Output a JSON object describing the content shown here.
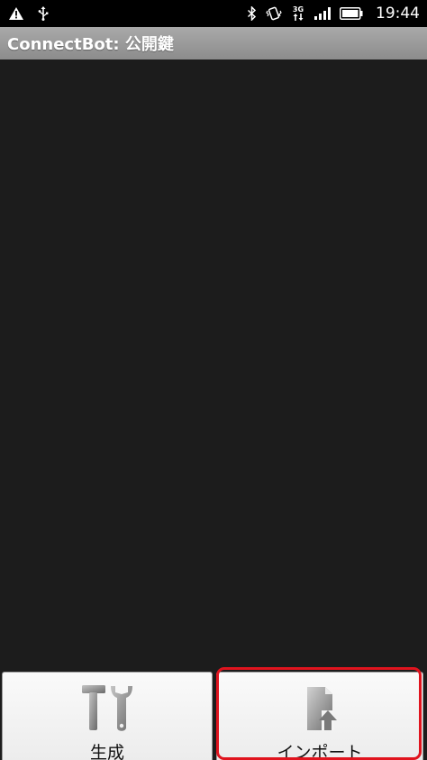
{
  "status_bar": {
    "time": "19:44",
    "network_type": "3G",
    "icons": [
      "warning-icon",
      "usb-icon",
      "bluetooth-icon",
      "vibrate-icon",
      "network-3g-icon",
      "signal-icon",
      "battery-icon"
    ]
  },
  "title_bar": {
    "title": "ConnectBot: 公開鍵"
  },
  "buttons": {
    "generate": {
      "label": "生成",
      "icon": "tools-icon"
    },
    "import": {
      "label": "インポート",
      "icon": "file-upload-icon"
    }
  },
  "colors": {
    "background": "#1c1c1c",
    "title_bar": "#9a9a9a",
    "highlight": "#e0141e"
  }
}
